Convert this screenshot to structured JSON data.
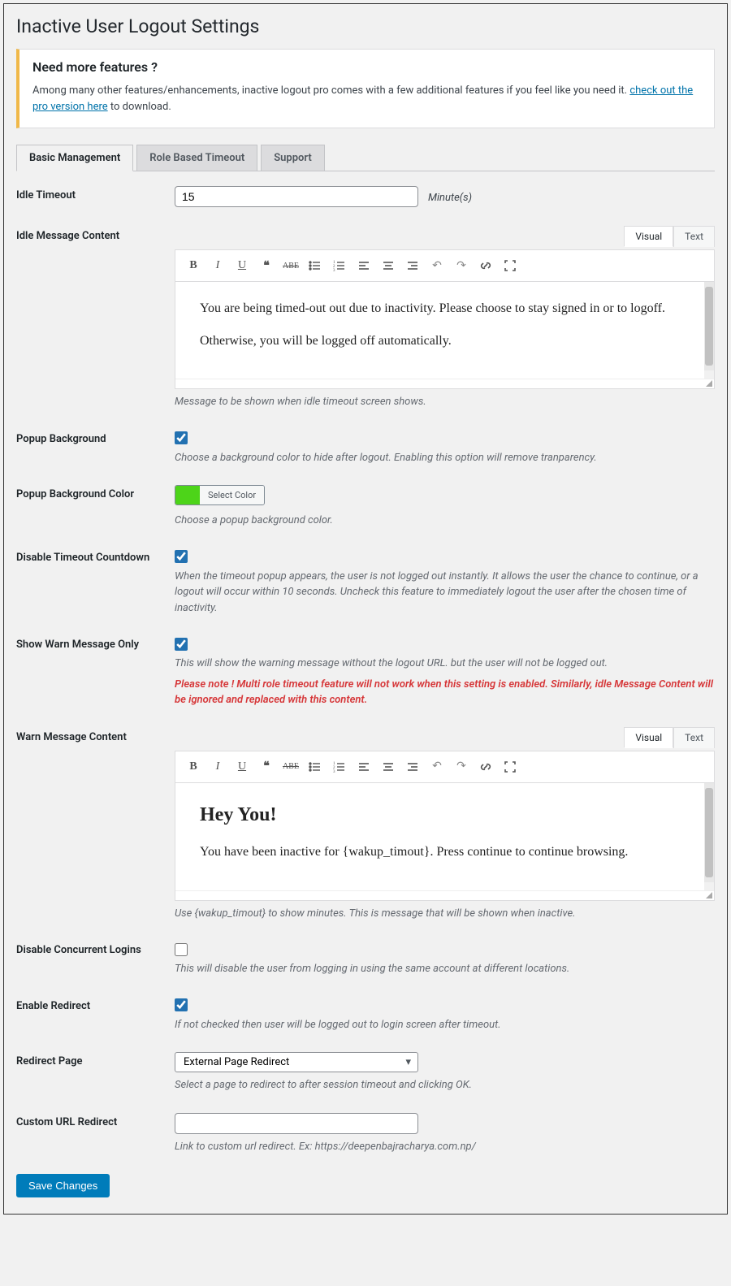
{
  "page_title": "Inactive User Logout Settings",
  "notice": {
    "heading": "Need more features ?",
    "text_before": "Among many other features/enhancements, inactive logout pro comes with a few additional features if you feel like you need it. ",
    "link_text": "check out the pro version here",
    "text_after": " to download."
  },
  "tabs": {
    "basic": "Basic Management",
    "role": "Role Based Timeout",
    "support": "Support"
  },
  "editor_tabs": {
    "visual": "Visual",
    "text": "Text"
  },
  "fields": {
    "idle_timeout": {
      "label": "Idle Timeout",
      "value": "15",
      "unit": "Minute(s)"
    },
    "idle_message": {
      "label": "Idle Message Content",
      "p1": "You are being timed-out out due to inactivity. Please choose to stay signed in or to logoff.",
      "p2": "Otherwise, you will be logged off automatically.",
      "desc": "Message to be shown when idle timeout screen shows."
    },
    "popup_bg": {
      "label": "Popup Background",
      "desc": "Choose a background color to hide after logout. Enabling this option will remove tranparency."
    },
    "popup_bg_color": {
      "label": "Popup Background Color",
      "btn": "Select Color",
      "swatch": "#4dd419",
      "desc": "Choose a popup background color."
    },
    "disable_countdown": {
      "label": "Disable Timeout Countdown",
      "desc": "When the timeout popup appears, the user is not logged out instantly. It allows the user the chance to continue, or a logout will occur within 10 seconds. Uncheck this feature to immediately logout the user after the chosen time of inactivity."
    },
    "warn_only": {
      "label": "Show Warn Message Only",
      "desc": "This will show the warning message without the logout URL. but the user will not be logged out.",
      "warn": "Please note ! Multi role timeout feature will not work when this setting is enabled. Similarly, idle Message Content will be ignored and replaced with this content."
    },
    "warn_message": {
      "label": "Warn Message Content",
      "h2": "Hey You!",
      "p1": "You have been inactive for {wakup_timout}. Press continue to continue browsing.",
      "desc": "Use {wakup_timout} to show minutes. This is message that will be shown when inactive."
    },
    "disable_concurrent": {
      "label": "Disable Concurrent Logins",
      "desc": "This will disable the user from logging in using the same account at different locations."
    },
    "enable_redirect": {
      "label": "Enable Redirect",
      "desc": "If not checked then user will be logged out to login screen after timeout."
    },
    "redirect_page": {
      "label": "Redirect Page",
      "value": "External Page Redirect",
      "desc": "Select a page to redirect to after session timeout and clicking OK."
    },
    "custom_url": {
      "label": "Custom URL Redirect",
      "value": "",
      "desc": "Link to custom url redirect. Ex: https://deepenbajracharya.com.np/"
    }
  },
  "submit": "Save Changes"
}
